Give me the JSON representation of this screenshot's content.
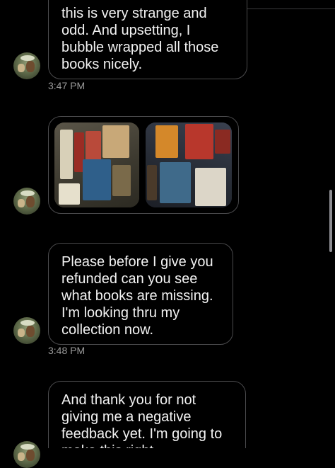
{
  "messages": [
    {
      "text": "this is very strange and\nodd. And upsetting, I\nbubble wrapped all those\nbooks nicely.",
      "timestamp": "3:47 PM"
    },
    {
      "type": "image_pair",
      "images": [
        "books-in-box-photo",
        "books-on-table-photo"
      ]
    },
    {
      "text": "Please before I give you\nrefunded can you see\nwhat books are missing.\nI'm looking thru my\ncollection now.",
      "timestamp": "3:48 PM"
    },
    {
      "text": "And thank you for not\ngiving me a negative\nfeedback yet. I'm going to\nmake this right"
    }
  ],
  "colors": {
    "background": "#000000",
    "bubble_border": "#4a4a4c",
    "text": "#f2f2f2",
    "timestamp": "#9a9a9a"
  }
}
